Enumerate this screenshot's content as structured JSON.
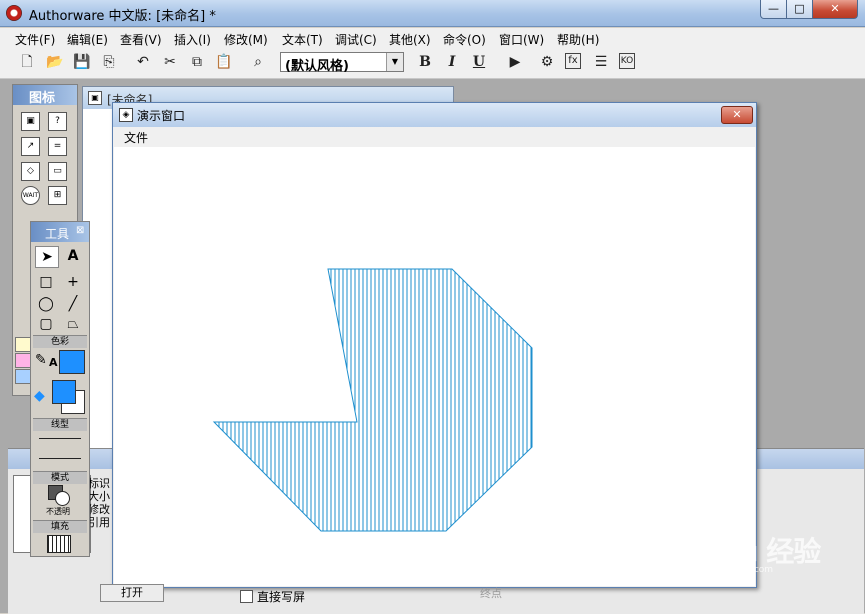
{
  "window": {
    "title": "Authorware 中文版: [未命名] *",
    "min_glyph": "—",
    "max_glyph": "□",
    "close_glyph": "✕"
  },
  "menubar": {
    "items": [
      "文件(F)",
      "编辑(E)",
      "查看(V)",
      "插入(I)",
      "修改(M)",
      "文本(T)",
      "调试(C)",
      "其他(X)",
      "命令(O)",
      "窗口(W)",
      "帮助(H)"
    ]
  },
  "toolbar": {
    "style_value": "(默认风格)",
    "bold": "B",
    "italic": "I",
    "underline": "U"
  },
  "icon_palette": {
    "title": "图标",
    "wait_label": "WAIT"
  },
  "flowline_window": {
    "title": "[未命名]"
  },
  "tools_palette": {
    "title": "工具",
    "text_tool": "A",
    "color_label": "色彩",
    "color_text_a": "A",
    "line_label": "线型",
    "mode_label": "模式",
    "mode_value": "不透明",
    "fill_label": "填充",
    "accent_color": "#1e90ff"
  },
  "props": {
    "lines": [
      "标识",
      "大小",
      "修改",
      "引用"
    ]
  },
  "presentation": {
    "title": "演示窗口",
    "menu_file": "文件",
    "shape_color": "#1e8fce"
  },
  "bottom": {
    "open_button": "打开",
    "direct_label": "直接写屏",
    "endpoint_label": "终点"
  },
  "watermark": {
    "text": "Bai du 经验",
    "sub": "jingyan.baidu.com"
  }
}
